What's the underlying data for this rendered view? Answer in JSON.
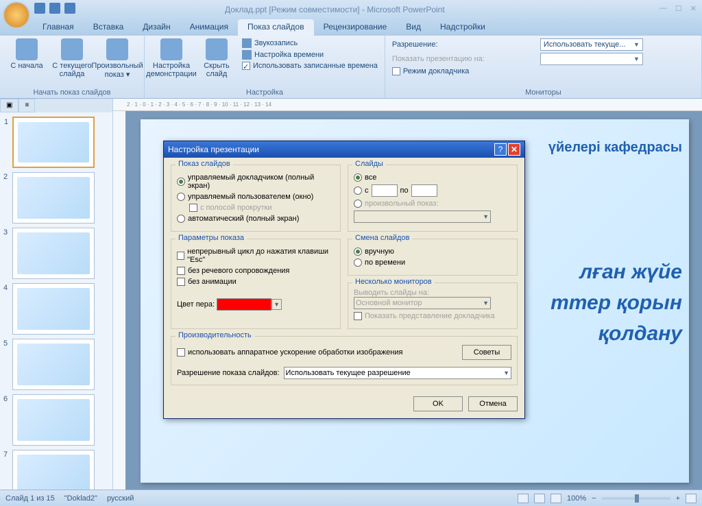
{
  "titlebar": {
    "text": "Доклад.ppt [Режим совместимости] - Microsoft PowerPoint"
  },
  "tabs": [
    "Главная",
    "Вставка",
    "Дизайн",
    "Анимация",
    "Показ слайдов",
    "Рецензирование",
    "Вид",
    "Надстройки"
  ],
  "active_tab": 4,
  "ribbon": {
    "group1_label": "Начать показ слайдов",
    "btn_from_start": "С начала",
    "btn_from_current": "С текущего слайда",
    "btn_custom": "Произвольный показ ▾",
    "group2_label": "Настройка",
    "btn_setup": "Настройка демонстрации",
    "btn_hide": "Скрыть слайд",
    "record": "Звукозапись",
    "rehearse": "Настройка времени",
    "use_timings": "Использовать записанные времена",
    "group3_label": "Мониторы",
    "resolution_label": "Разрешение:",
    "show_on_label": "Показать презентацию на:",
    "presenter_view": "Режим докладчика",
    "resolution_value": "Использовать текуще..."
  },
  "thumbs": [
    1,
    2,
    3,
    4,
    5,
    6,
    7
  ],
  "slide": {
    "header_frag": "үйелері кафедрасы",
    "body_frag": "лған жүйе\nттер қорын\nқолдану"
  },
  "dialog": {
    "title": "Настройка презентации",
    "show_type": {
      "legend": "Показ слайдов",
      "opt1": "управляемый докладчиком (полный экран)",
      "opt2": "управляемый пользователем (окно)",
      "scrollbar": "с полосой прокрутки",
      "opt3": "автоматический (полный экран)"
    },
    "slides": {
      "legend": "Слайды",
      "all": "все",
      "from": "с",
      "to": "по",
      "custom": "произвольный показ:"
    },
    "options": {
      "legend": "Параметры показа",
      "loop": "непрерывный цикл до нажатия клавиши \"Esc\"",
      "no_narration": "без речевого сопровождения",
      "no_animation": "без анимации",
      "pen_label": "Цвет пера:"
    },
    "advance": {
      "legend": "Смена слайдов",
      "manual": "вручную",
      "timings": "по времени"
    },
    "monitors": {
      "legend": "Несколько мониторов",
      "display_on": "Выводить слайды на:",
      "primary": "Основной монитор",
      "presenter": "Показать представление докладчика"
    },
    "performance": {
      "legend": "Производительность",
      "hardware": "использовать аппаратное ускорение обработки изображения",
      "tips": "Советы",
      "resolution_label": "Разрешение показа слайдов:",
      "resolution_value": "Использовать текущее разрешение"
    },
    "ok": "OK",
    "cancel": "Отмена"
  },
  "status": {
    "slide_of": "Слайд 1 из 15",
    "theme": "\"Doklad2\"",
    "lang": "русский",
    "zoom": "100%"
  }
}
